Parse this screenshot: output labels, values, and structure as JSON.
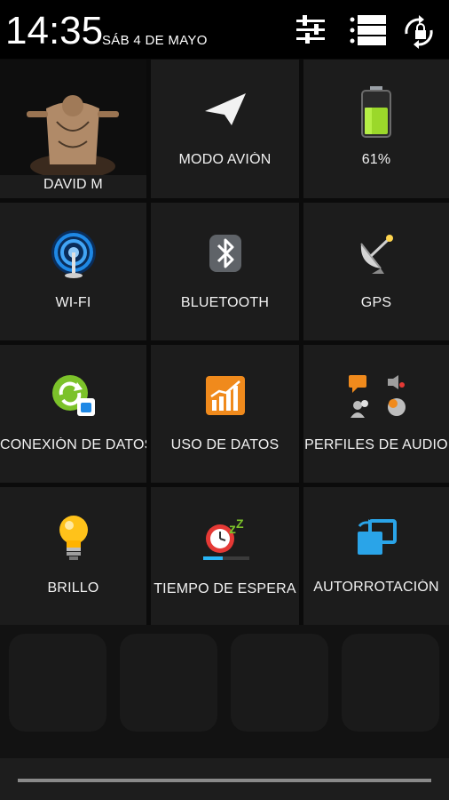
{
  "status": {
    "time": "14:35",
    "date": "SÁB 4 DE MAYO",
    "icons": [
      "settings-sliders-icon",
      "notification-list-icon",
      "rotation-lock-icon"
    ]
  },
  "tiles": [
    {
      "label": "DAVID M",
      "icon": "user-avatar"
    },
    {
      "label": "MODO AVIÓN",
      "icon": "airplane-icon"
    },
    {
      "label": "61%",
      "icon": "battery-icon",
      "level": 0.61
    },
    {
      "label": "WI-FI",
      "icon": "wifi-icon"
    },
    {
      "label": "BLUETOOTH",
      "icon": "bluetooth-icon"
    },
    {
      "label": "GPS",
      "icon": "gps-satellite-icon"
    },
    {
      "label": "CONEXIÓN DE DATOS",
      "icon": "data-connection-icon"
    },
    {
      "label": "USO DE DATOS",
      "icon": "data-usage-icon"
    },
    {
      "label": "PERFILES DE AUDIO",
      "icon": "audio-profiles-icon"
    },
    {
      "label": "BRILLO",
      "icon": "brightness-bulb-icon"
    },
    {
      "label": "TIEMPO DE ESPERA",
      "icon": "sleep-timeout-icon"
    },
    {
      "label": "AUTORROTACIÓN",
      "icon": "auto-rotate-icon"
    }
  ],
  "colors": {
    "tile_bg": "#1c1c1c",
    "wifi_blue": "#1e88e5",
    "data_green": "#7cc22a",
    "orange": "#f08a1c",
    "bulb": "#ffc21a",
    "rotate_blue": "#2aa4e8"
  }
}
